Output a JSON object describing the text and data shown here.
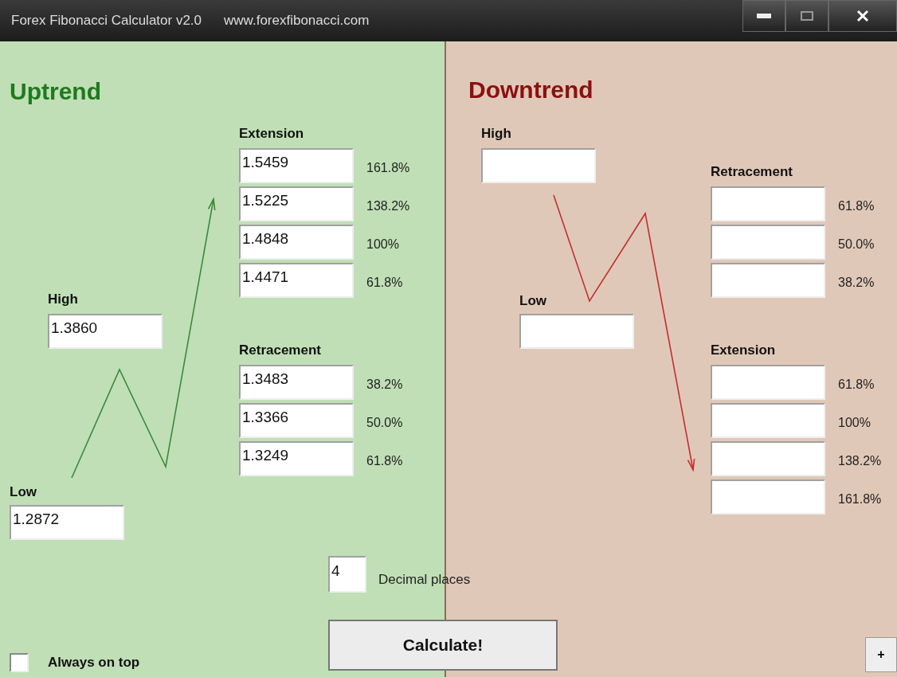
{
  "window": {
    "title": "Forex Fibonacci Calculator v2.0",
    "url": "www.forexfibonacci.com"
  },
  "uptrend": {
    "title": "Uptrend",
    "extension": {
      "label": "Extension",
      "rows": [
        {
          "value": "1.5459",
          "percent": "161.8%"
        },
        {
          "value": "1.5225",
          "percent": "138.2%"
        },
        {
          "value": "1.4848",
          "percent": "100%"
        },
        {
          "value": "1.4471",
          "percent": "61.8%"
        }
      ]
    },
    "high": {
      "label": "High",
      "value": "1.3860"
    },
    "retracement": {
      "label": "Retracement",
      "rows": [
        {
          "value": "1.3483",
          "percent": "38.2%"
        },
        {
          "value": "1.3366",
          "percent": "50.0%"
        },
        {
          "value": "1.3249",
          "percent": "61.8%"
        }
      ]
    },
    "low": {
      "label": "Low",
      "value": "1.2872"
    }
  },
  "downtrend": {
    "title": "Downtrend",
    "high": {
      "label": "High"
    },
    "retracement": {
      "label": "Retracement",
      "rows": [
        {
          "percent": "61.8%"
        },
        {
          "percent": "50.0%"
        },
        {
          "percent": "38.2%"
        }
      ]
    },
    "low": {
      "label": "Low"
    },
    "extension": {
      "label": "Extension",
      "rows": [
        {
          "percent": "61.8%"
        },
        {
          "percent": "100%"
        },
        {
          "percent": "138.2%"
        },
        {
          "percent": "161.8%"
        }
      ]
    }
  },
  "decimal_places": {
    "value": "4",
    "label": "Decimal places"
  },
  "calculate_button": "Calculate!",
  "always_on_top": {
    "label": "Always on top",
    "checked": false
  },
  "expand_button": "+"
}
